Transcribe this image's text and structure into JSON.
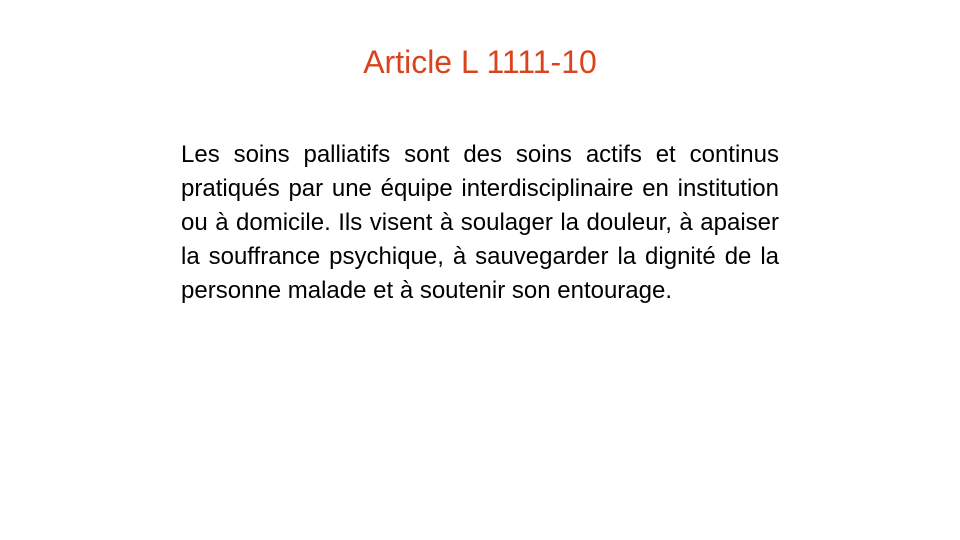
{
  "slide": {
    "title": "Article L 1111-10",
    "body": "Les soins palliatifs sont des soins actifs et continus pratiqués par une équipe interdisciplinaire en institution ou à domicile. Ils visent à soulager la douleur, à apaiser la souffrance psychique, à sauvegarder la dignité de la personne malade et à soutenir son entourage."
  },
  "colors": {
    "title": "#d9441c",
    "body": "#000000",
    "background": "#ffffff"
  }
}
